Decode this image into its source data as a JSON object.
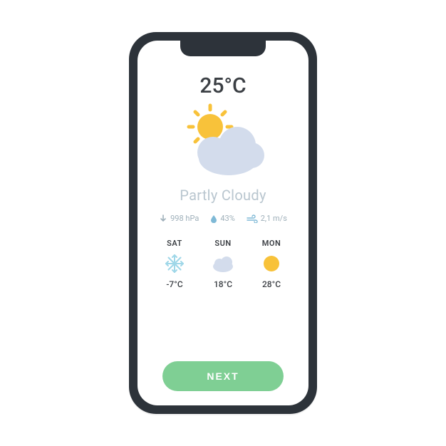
{
  "current": {
    "temperature": "25°C",
    "condition": "Partly Cloudy",
    "icon": "partly-cloudy"
  },
  "metrics": {
    "pressure": "998 hPa",
    "humidity": "43%",
    "wind": "2,1 m/s"
  },
  "forecast": [
    {
      "day": "SAT",
      "icon": "snow",
      "temp": "-7°C"
    },
    {
      "day": "SUN",
      "icon": "cloud",
      "temp": "18°C"
    },
    {
      "day": "MON",
      "icon": "sun",
      "temp": "28°C"
    }
  ],
  "actions": {
    "next": "NEXT"
  },
  "colors": {
    "accent": "#7fcf94",
    "sun": "#f8c23a",
    "cloud": "#d3dcec",
    "snow": "#9fd7e8",
    "muted": "#9fb0ba"
  }
}
